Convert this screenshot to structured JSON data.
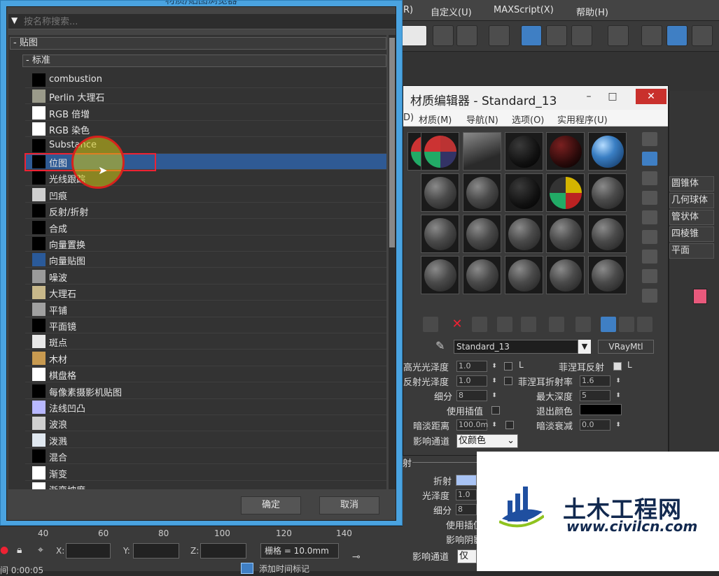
{
  "max_menu": [
    "R)",
    "自定义(U)",
    "MAXScript(X)",
    "帮助(H)"
  ],
  "command_panel": {
    "items": [
      "圆锥体",
      "几何球体",
      "管状体",
      "四棱锥",
      "平面"
    ]
  },
  "material_editor": {
    "title": "材质编辑器 - Standard_13",
    "menu": [
      "D)",
      "材质(M)",
      "导航(N)",
      "选项(O)",
      "实用程序(U)"
    ],
    "material_name": "Standard_13",
    "material_type": "VRayMtl",
    "params": {
      "gloss_label": "高光光泽度",
      "gloss_value": "1.0",
      "refl_gloss_label": "反射光泽度",
      "refl_gloss_value": "1.0",
      "subdivs_label": "细分",
      "subdivs_value": "8",
      "interp_label": "使用插值",
      "dim_dist_label": "暗淡距离",
      "dim_dist_value": "100.0m",
      "affect_channels_label": "影响通道",
      "affect_channels_value": "仅颜色",
      "fresnel_label": "菲涅耳反射",
      "fresnel_check": "L",
      "fresnel_ior_label": "菲涅耳折射率",
      "fresnel_ior_value": "1.6",
      "max_depth_label": "最大深度",
      "max_depth_value": "5",
      "exit_color_label": "退出颜色",
      "dim_falloff_label": "暗淡衰减",
      "dim_falloff_value": "0.0",
      "lower_section": "射",
      "refraction_label": "折射",
      "refr_gloss_label": "光泽度",
      "refr_gloss_value": "1.0",
      "refr_subdivs_label": "细分",
      "refr_subdivs_value": "8",
      "refr_interp_label": "使用插值",
      "affect_shadows_label": "影响阴影",
      "refr_affect_channels_label": "影响通道",
      "refr_affect_channels_value": "仅颜色"
    }
  },
  "status_bar": {
    "ruler": [
      "40",
      "60",
      "80",
      "100",
      "120",
      "140"
    ],
    "x_label": "X:",
    "y_label": "Y:",
    "z_label": "Z:",
    "grid": "栅格 = 10.0mm",
    "time": "0:00:05",
    "time_prefix": "间",
    "add_time_tag": "添加时间标记"
  },
  "browser": {
    "title": "材质/贴图浏览器",
    "search_placeholder": "按名称搜索...",
    "group_maps": "- 贴图",
    "group_standard": "- 标准",
    "items": [
      {
        "label": "combustion",
        "swatch": "#000000"
      },
      {
        "label": "Perlin 大理石",
        "swatch": "#9a9a8a"
      },
      {
        "label": "RGB 倍增",
        "swatch": "#ffffff"
      },
      {
        "label": "RGB 染色",
        "swatch": "#ffffff"
      },
      {
        "label": "Substance",
        "swatch": "#000000"
      },
      {
        "label": "位图",
        "swatch": "#000000"
      },
      {
        "label": "光线跟踪",
        "swatch": "#000000"
      },
      {
        "label": "凹痕",
        "swatch": "#cfcfcf"
      },
      {
        "label": "反射/折射",
        "swatch": "#000000"
      },
      {
        "label": "合成",
        "swatch": "#000000"
      },
      {
        "label": "向量置换",
        "swatch": "#000000"
      },
      {
        "label": "向量贴图",
        "swatch": "#2a5a9a"
      },
      {
        "label": "噪波",
        "swatch": "#9a9a9a"
      },
      {
        "label": "大理石",
        "swatch": "#c8b88a"
      },
      {
        "label": "平铺",
        "swatch": "#a0a0a0"
      },
      {
        "label": "平面镜",
        "swatch": "#000000"
      },
      {
        "label": "斑点",
        "swatch": "#e8e8e8"
      },
      {
        "label": "木材",
        "swatch": "#c89a50"
      },
      {
        "label": "棋盘格",
        "swatch": "#ffffff"
      },
      {
        "label": "每像素摄影机贴图",
        "swatch": "#000000"
      },
      {
        "label": "法线凹凸",
        "swatch": "#b8b8ff"
      },
      {
        "label": "波浪",
        "swatch": "#d0d0d0"
      },
      {
        "label": "泼溅",
        "swatch": "#e0e8f0"
      },
      {
        "label": "混合",
        "swatch": "#000000"
      },
      {
        "label": "渐变",
        "swatch": "#ffffff"
      },
      {
        "label": "渐变坡度",
        "swatch": "#ffffff"
      }
    ],
    "selected_index": 5,
    "ok_label": "确定",
    "cancel_label": "取消"
  },
  "watermark": {
    "title": "土木工程网",
    "url": "www.civilcn.com"
  }
}
